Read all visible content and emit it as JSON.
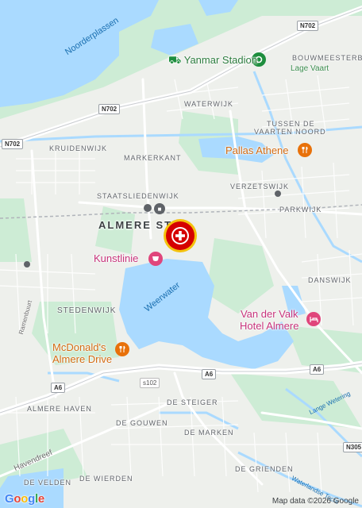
{
  "map": {
    "water_labels": {
      "noorderplassen": "Noorderplassen",
      "weerwater": "Weerwater",
      "lange_wetering": "Lange Wetering",
      "waterlandse_tocht": "Waterlandse Tocht"
    },
    "road_labels": {
      "ramenbuurt": "Ramenbuurt",
      "havendreef": "Havendreef"
    },
    "route_shields": {
      "n702_top": "N702",
      "n702_mid": "N702",
      "n702_left": "N702",
      "a6_center": "A6",
      "a6_left": "A6",
      "a6_right": "A6",
      "s102": "s102",
      "n305": "N305"
    },
    "districts": {
      "waterwijk": "WATERWIJK",
      "bouwmeesterbuurt": "BOUWMEESTERBU",
      "tussen_de_vaarten_noord_1": "TUSSEN DE",
      "tussen_de_vaarten_noord_2": "VAARTEN NOORD",
      "kruidenwijk": "KRUIDENWIJK",
      "markerkant": "MARKERKANT",
      "staatsliedenwijk": "STAATSLIEDENWIJK",
      "verzetswijk": "VERZETSWIJK",
      "parkwijk": "PARKWIJK",
      "danswijk": "DANSWIJK",
      "stedenwijk": "STEDENWIJK",
      "almere_haven": "ALMERE HAVEN",
      "de_steiger": "DE STEIGER",
      "de_gouwen": "DE GOUWEN",
      "de_marken": "DE MARKEN",
      "de_grienden": "DE GRIENDEN",
      "de_velden": "DE VELDEN",
      "de_wierden": "DE WIERDEN"
    },
    "city_label": "ALMERE ST",
    "pois": {
      "yanmar_stadion": "Yanmar Stadion",
      "lage_vaart": "Lage Vaart",
      "pallas_athene": "Pallas Athene",
      "kunstlinie": "Kunstlinie",
      "mcdonalds_line1": "McDonald's",
      "mcdonalds_line2": "Almere Drive",
      "vandervalk_line1": "Van der Valk",
      "vandervalk_line2": "Hotel Almere"
    },
    "marker_icon": "hospital-cross-icon",
    "colors": {
      "water": "#aadaff",
      "park": "#c8ebd2",
      "urban": "#eeeeee",
      "highway": "#ffffff",
      "marker_red": "#d50000",
      "marker_gold": "#f4c20d",
      "poi_orange": "#e8710a",
      "poi_pink": "#e0457b",
      "poi_green": "#1e8e3e"
    }
  },
  "footer": {
    "google_logo": "Google",
    "attribution": "Map data ©2026 Google"
  }
}
